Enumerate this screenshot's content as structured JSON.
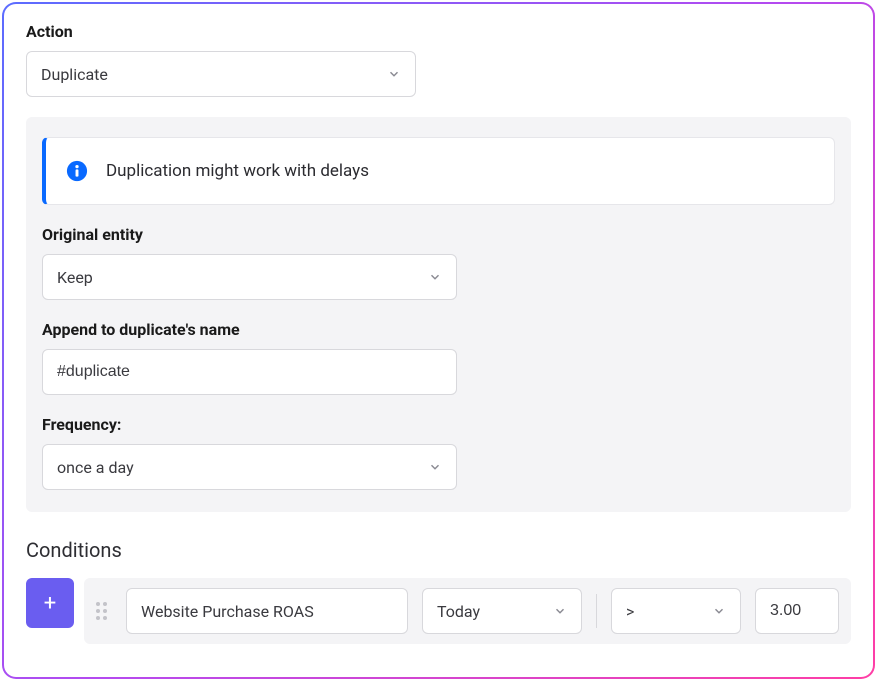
{
  "action": {
    "label": "Action",
    "value": "Duplicate"
  },
  "alert": {
    "text": "Duplication might work with delays"
  },
  "original_entity": {
    "label": "Original entity",
    "value": "Keep"
  },
  "append_name": {
    "label": "Append to duplicate's name",
    "value": "#duplicate"
  },
  "frequency": {
    "label": "Frequency:",
    "value": "once a day"
  },
  "conditions": {
    "title": "Conditions",
    "add_label": "+",
    "row": {
      "metric": "Website Purchase ROAS",
      "timeframe": "Today",
      "operator": ">",
      "value": "3.00"
    }
  }
}
